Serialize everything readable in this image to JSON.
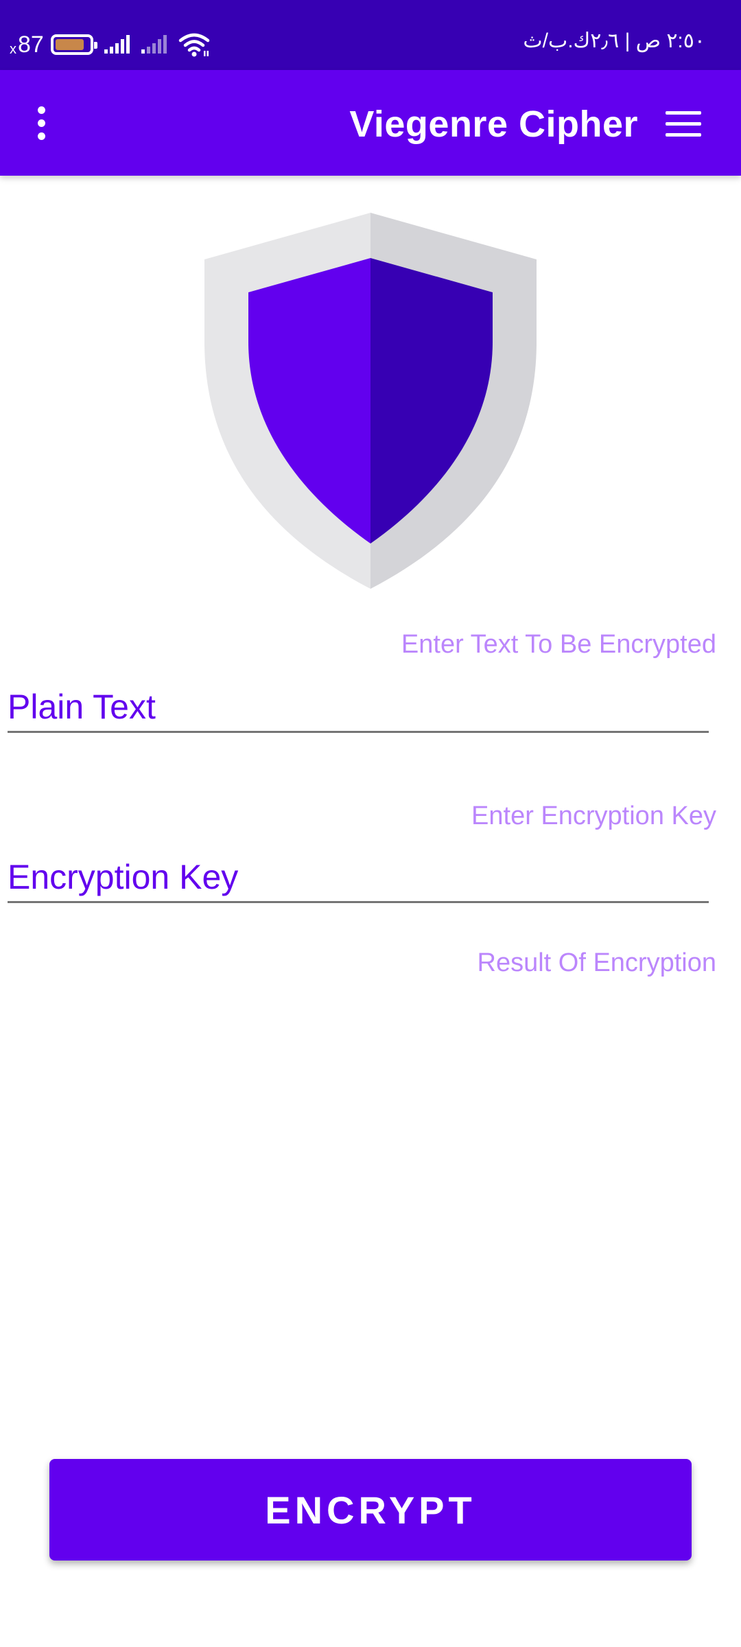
{
  "status_bar": {
    "battery_prefix": "x",
    "battery_percent": "87",
    "battery_level": 0.87,
    "clock_text": "٢:٥٠ ص | ٢٫٦ك.ب/ث",
    "icons": [
      "battery-icon",
      "signal-icon",
      "signal-weak-icon",
      "wifi-icon"
    ]
  },
  "app_bar": {
    "title": "Viegenre Cipher",
    "overflow_icon": "more-vert-icon",
    "menu_icon": "hamburger-menu-icon"
  },
  "logo": {
    "icon": "shield-icon"
  },
  "form": {
    "plain_text_label": "Enter Text To Be Encrypted",
    "plain_text_value": "",
    "plain_text_placeholder": "Plain Text",
    "key_label": "Enter Encryption Key",
    "key_value": "",
    "key_placeholder": "Encryption Key",
    "result_label": "Result Of Encryption",
    "result_value": ""
  },
  "actions": {
    "encrypt_label": "ENCRYPT"
  },
  "colors": {
    "primary": "#6200ee",
    "primary_dark": "#3700b3",
    "label": "#bb86fc",
    "shield_light": "#e6e6e8",
    "shield_shade": "#d4d4d8"
  }
}
